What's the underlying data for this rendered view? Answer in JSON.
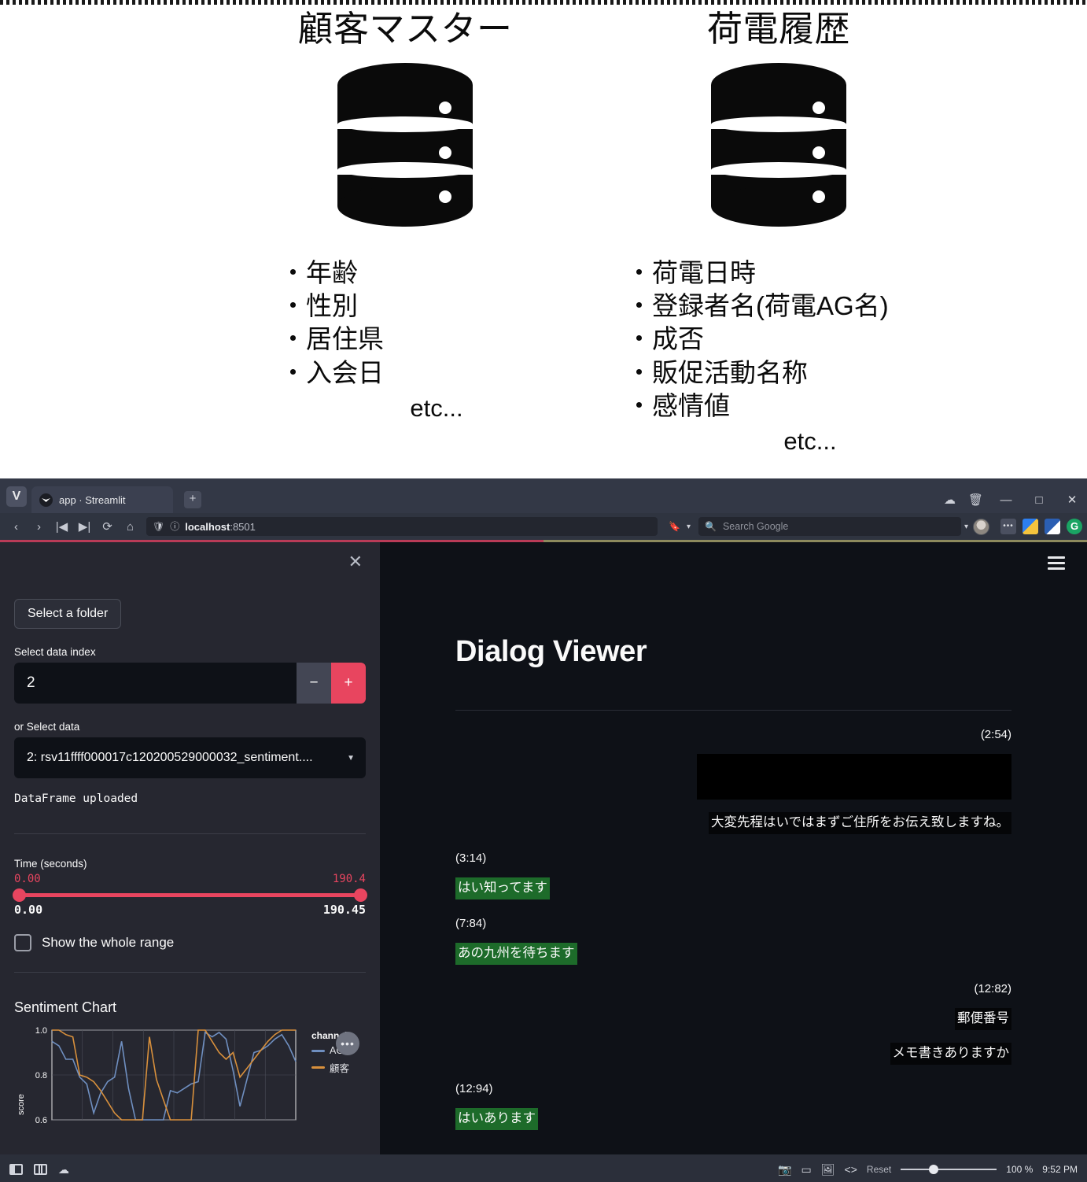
{
  "slide": {
    "columns": [
      {
        "title": "顧客マスター",
        "icon": "database-icon",
        "bullets": [
          "・年齢",
          "・性別",
          "・居住県",
          "・入会日"
        ],
        "etc": "etc..."
      },
      {
        "title": "荷電履歴",
        "icon": "database-icon",
        "bullets": [
          "・荷電日時",
          "・登録者名(荷電AG名)",
          "・成否",
          "・販促活動名称",
          "・感情値"
        ],
        "etc": "etc..."
      }
    ]
  },
  "browser": {
    "app_logo": "V",
    "tab": {
      "title": "app · Streamlit",
      "favicon": "streamlit-icon"
    },
    "new_tab_label": "+",
    "window_controls": {
      "minimize": "—",
      "maximize": "□",
      "close": "✕"
    },
    "title_icons": [
      "cloud-icon",
      "trash-icon"
    ],
    "nav": {
      "back": "‹",
      "forward": "›",
      "rewind": "|◀",
      "fastforward": "▶|",
      "reload": "⟳",
      "home": "⌂"
    },
    "url": {
      "prefix": "localhost",
      "suffix": ":8501",
      "shield_icon": "shield-icon",
      "info_icon": "info-icon"
    },
    "bookmark_icon": "bookmark-icon",
    "search": {
      "placeholder": "Search Google",
      "icon": "search-icon",
      "caret": "▾"
    },
    "extensions": [
      "dots-extension-icon",
      "drive-extension-icon",
      "office-extension-icon",
      "grammarly-extension-icon"
    ]
  },
  "sidebar": {
    "close_label": "✕",
    "folder_button": "Select a folder",
    "index_label": "Select data index",
    "index_value": "2",
    "step_minus": "−",
    "step_plus": "+",
    "select_label": "or Select data",
    "select_value": "2: rsv11ffff000017c120200529000032_sentiment....",
    "select_caret": "▼",
    "status_note": "DataFrame uploaded",
    "slider_label": "Time (seconds)",
    "slider_low": "0.00",
    "slider_high": "190.4",
    "slider_min": "0.00",
    "slider_max": "190.45",
    "checkbox_label": "Show the whole range",
    "chart_title": "Sentiment Chart",
    "chart_menu": "•••"
  },
  "chart_data": {
    "type": "line",
    "title": "Sentiment Chart",
    "xlabel": "",
    "ylabel": "score",
    "ylim": [
      0.6,
      1.0
    ],
    "yticks": [
      0.6,
      0.8,
      1.0
    ],
    "grid": true,
    "legend_title": "channel",
    "legend_position": "right",
    "series": [
      {
        "name": "AG",
        "color": "#6f8fc0",
        "values": [
          0.95,
          0.93,
          0.87,
          0.87,
          0.79,
          0.76,
          0.63,
          0.72,
          0.77,
          0.79,
          0.95,
          0.74,
          0.6,
          0.6,
          0.6,
          0.6,
          0.6,
          0.73,
          0.72,
          0.74,
          0.76,
          0.77,
          0.99,
          0.97,
          0.99,
          0.96,
          0.82,
          0.66,
          0.78,
          0.9,
          0.91,
          0.93,
          0.96,
          0.98,
          0.93,
          0.86
        ]
      },
      {
        "name": "顧客",
        "color": "#d8903c",
        "values": [
          1.0,
          1.0,
          0.98,
          0.97,
          0.8,
          0.79,
          0.77,
          0.73,
          0.68,
          0.63,
          0.6,
          0.6,
          0.6,
          0.6,
          0.97,
          0.78,
          0.69,
          0.6,
          0.6,
          0.6,
          0.6,
          1.0,
          1.0,
          0.95,
          0.9,
          0.87,
          0.9,
          0.79,
          0.83,
          0.87,
          0.91,
          0.95,
          0.98,
          1.0,
          1.0,
          1.0
        ]
      }
    ]
  },
  "main": {
    "page_title": "Dialog Viewer",
    "menu_icon": "hamburger-icon",
    "messages": [
      {
        "time": "(2:54)",
        "side": "right",
        "redacted": true,
        "lines": [
          {
            "text": "大変先程はいではまずご住所をお伝え致しますね。",
            "style": "dark"
          }
        ]
      },
      {
        "time": "(3:14)",
        "side": "left",
        "redacted": false,
        "lines": [
          {
            "text": "はい知ってます",
            "style": "green"
          }
        ]
      },
      {
        "time": "(7:84)",
        "side": "left",
        "redacted": false,
        "lines": [
          {
            "text": "あの九州を待ちます",
            "style": "green"
          }
        ]
      },
      {
        "time": "(12:82)",
        "side": "right",
        "redacted": false,
        "lines": [
          {
            "text": "郵便番号",
            "style": "dark"
          },
          {
            "text": "メモ書きありますか",
            "style": "dark"
          }
        ]
      },
      {
        "time": "(12:94)",
        "side": "left",
        "redacted": false,
        "lines": [
          {
            "text": "はいあります",
            "style": "green"
          }
        ]
      }
    ]
  },
  "statusbar": {
    "left_icons": [
      "panel-left-icon",
      "panel-split-icon",
      "cloud-icon"
    ],
    "right_icons": [
      "camera-icon",
      "screen-icon",
      "image-icon",
      "code-icon"
    ],
    "reset_label": "Reset",
    "zoom_value": "100 %",
    "clock": "9:52 PM"
  },
  "colors": {
    "accent": "#e8455f",
    "sidebar_bg": "#262730",
    "app_bg": "#0e1117",
    "highlight_green": "#1d6b2a",
    "series_ag": "#6f8fc0",
    "series_kokyaku": "#d8903c"
  }
}
